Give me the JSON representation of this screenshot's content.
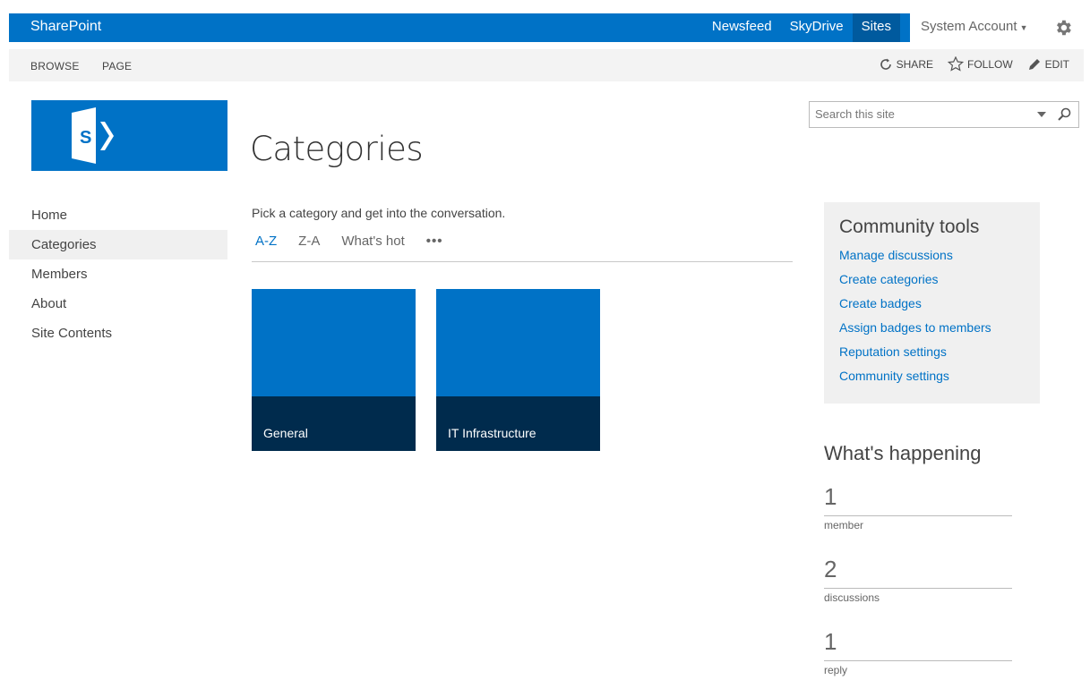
{
  "suitebar": {
    "brand": "SharePoint",
    "links": [
      "Newsfeed",
      "SkyDrive",
      "Sites"
    ],
    "active_link": "Sites",
    "account": "System Account",
    "accent_color": "#0072c6"
  },
  "ribbon": {
    "tabs": [
      "BROWSE",
      "PAGE"
    ],
    "share": "SHARE",
    "follow": "FOLLOW",
    "edit": "EDIT"
  },
  "search": {
    "placeholder": "Search this site"
  },
  "nav": {
    "items": [
      "Home",
      "Categories",
      "Members",
      "About",
      "Site Contents"
    ],
    "selected": "Categories"
  },
  "page": {
    "title": "Categories",
    "intro": "Pick a category and get into the conversation.",
    "sort_tabs": [
      "A-Z",
      "Z-A",
      "What's hot",
      "•••"
    ],
    "active_sort": "A-Z"
  },
  "tiles": [
    {
      "label": "General"
    },
    {
      "label": "IT Infrastructure"
    }
  ],
  "community_tools": {
    "title": "Community tools",
    "links": [
      "Manage discussions",
      "Create categories",
      "Create badges",
      "Assign badges to members",
      "Reputation settings",
      "Community settings"
    ]
  },
  "whats_happening": {
    "title": "What's happening",
    "stats": [
      {
        "value": "1",
        "label": "member"
      },
      {
        "value": "2",
        "label": "discussions"
      },
      {
        "value": "1",
        "label": "reply"
      }
    ]
  }
}
